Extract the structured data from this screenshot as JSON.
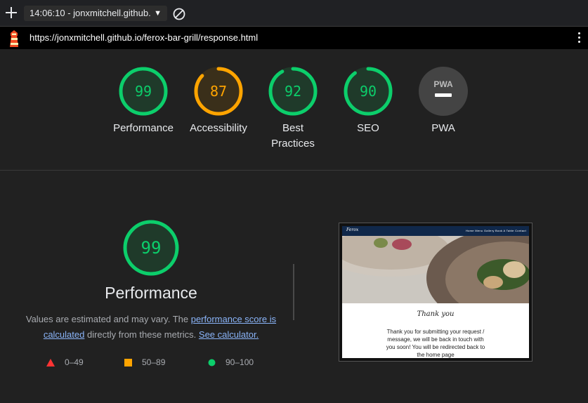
{
  "toolbar": {
    "new_icon": "plus-icon",
    "report_label": "14:06:10 - jonxmitchell.github.",
    "clear_icon": "block-icon"
  },
  "urlbar": {
    "app_icon": "lighthouse-icon",
    "url": "https://jonxmitchell.github.io/ferox-bar-grill/response.html",
    "menu_icon": "kebab-menu-icon"
  },
  "gauges": [
    {
      "score": "99",
      "label": "Performance",
      "value": 0.99,
      "status": "pass"
    },
    {
      "score": "87",
      "label": "Accessibility",
      "value": 0.87,
      "status": "average"
    },
    {
      "score": "92",
      "label": "Best Practices",
      "label_line1": "Best",
      "label_line2": "Practices",
      "value": 0.92,
      "status": "pass"
    },
    {
      "score": "90",
      "label": "SEO",
      "value": 0.9,
      "status": "pass"
    },
    {
      "score": "—",
      "label": "PWA",
      "badge": "PWA"
    }
  ],
  "performance": {
    "score": "99",
    "value": 0.99,
    "title": "Performance",
    "desc_prefix": "Values are estimated and may vary. The ",
    "desc_link": "performance score is calculated",
    "desc_middle": " directly from these metrics. ",
    "desc_link2": "See calculator."
  },
  "legend": [
    {
      "icon": "triangle-icon",
      "range": "0–49",
      "color": "#ff3333"
    },
    {
      "icon": "square-icon",
      "range": "50–89",
      "color": "#ffa400"
    },
    {
      "icon": "circle-icon",
      "range": "90–100",
      "color": "#0cce6b"
    }
  ],
  "thumbnail": {
    "logo": "Ferox",
    "nav_links": "Home  Menu  Gallery  Book A Table  Contact",
    "thank_you": "Thank you",
    "message": "Thank you for submitting your request / message, we will be back in touch with you soon! You will be redirected back to the home page"
  },
  "colors": {
    "pass": "#0cce6b",
    "pass_bg": "#1f3a2a",
    "average": "#ffa400",
    "average_bg": "#3a2f1a",
    "fail": "#ff3333"
  }
}
